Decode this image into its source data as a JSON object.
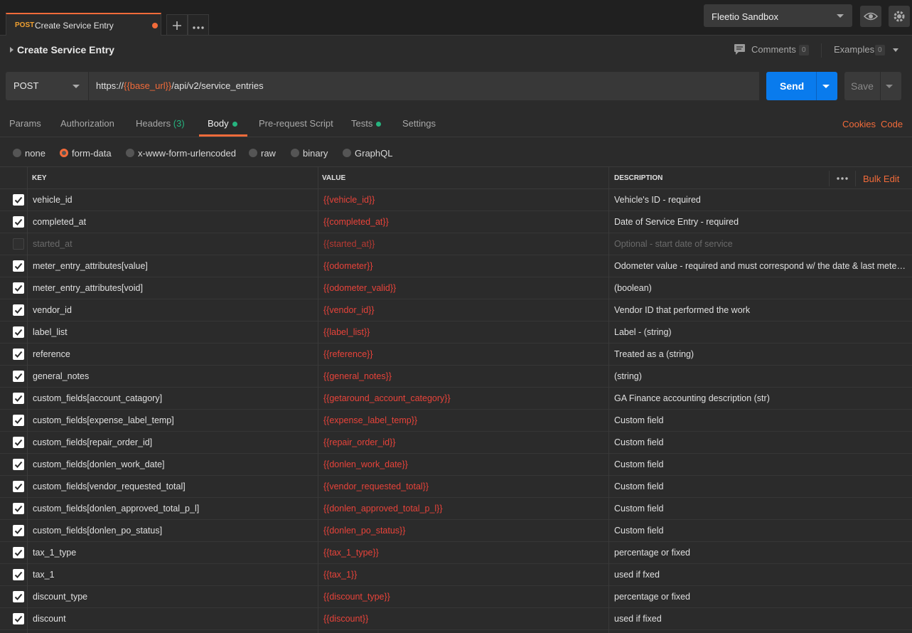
{
  "tab": {
    "method": "POST",
    "name": "Create Service Entry"
  },
  "environment": {
    "selected": "Fleetio Sandbox"
  },
  "request": {
    "title": "Create Service Entry",
    "comments_label": "Comments",
    "comments_count": "0",
    "examples_label": "Examples",
    "examples_count": "0",
    "method": "POST",
    "url_prefix": "https://",
    "url_var": "{{base_url}}",
    "url_suffix": "/api/v2/service_entries",
    "send_label": "Send",
    "save_label": "Save"
  },
  "subtabs": {
    "params": "Params",
    "authorization": "Authorization",
    "headers": "Headers",
    "headers_count": "(3)",
    "body": "Body",
    "prerequest": "Pre-request Script",
    "tests": "Tests",
    "settings": "Settings",
    "cookies": "Cookies",
    "code": "Code"
  },
  "body_types": [
    "none",
    "form-data",
    "x-www-form-urlencoded",
    "raw",
    "binary",
    "GraphQL"
  ],
  "body_type_selected": "form-data",
  "table": {
    "headers": {
      "key": "KEY",
      "value": "VALUE",
      "description": "DESCRIPTION",
      "bulk_edit": "Bulk Edit"
    },
    "rows": [
      {
        "checked": true,
        "key": "vehicle_id",
        "value": "{{vehicle_id}}",
        "description": "Vehicle's ID - required"
      },
      {
        "checked": true,
        "key": "completed_at",
        "value": "{{completed_at}}",
        "description": "Date of Service Entry - required"
      },
      {
        "checked": false,
        "key": "started_at",
        "value": "{{started_at}}",
        "description": "Optional - start date of service"
      },
      {
        "checked": true,
        "key": "meter_entry_attributes[value]",
        "value": "{{odometer}}",
        "description": "Odometer value - required and must correspond w/ the date & last meter entry"
      },
      {
        "checked": true,
        "key": "meter_entry_attributes[void]",
        "value": "{{odometer_valid}}",
        "description": "(boolean)"
      },
      {
        "checked": true,
        "key": "vendor_id",
        "value": "{{vendor_id}}",
        "description": "Vendor ID that performed the work"
      },
      {
        "checked": true,
        "key": "label_list",
        "value": "{{label_list}}",
        "description": "Label - (string)"
      },
      {
        "checked": true,
        "key": "reference",
        "value": "{{reference}}",
        "description": "Treated as a (string)"
      },
      {
        "checked": true,
        "key": "general_notes",
        "value": "{{general_notes}}",
        "description": "(string)"
      },
      {
        "checked": true,
        "key": "custom_fields[account_catagory]",
        "value": "{{getaround_account_category}}",
        "description": "GA Finance accounting description (str)"
      },
      {
        "checked": true,
        "key": "custom_fields[expense_label_temp]",
        "value": "{{expense_label_temp}}",
        "description": "Custom field"
      },
      {
        "checked": true,
        "key": "custom_fields[repair_order_id]",
        "value": "{{repair_order_id}}",
        "description": "Custom field"
      },
      {
        "checked": true,
        "key": "custom_fields[donlen_work_date]",
        "value": "{{donlen_work_date}}",
        "description": "Custom field"
      },
      {
        "checked": true,
        "key": "custom_fields[vendor_requested_total]",
        "value": "{{vendor_requested_total}}",
        "description": "Custom field"
      },
      {
        "checked": true,
        "key": "custom_fields[donlen_approved_total_p_l]",
        "value": "{{donlen_approved_total_p_l}}",
        "description": "Custom field"
      },
      {
        "checked": true,
        "key": "custom_fields[donlen_po_status]",
        "value": "{{donlen_po_status}}",
        "description": "Custom field"
      },
      {
        "checked": true,
        "key": "tax_1_type",
        "value": "{{tax_1_type}}",
        "description": "percentage or fixed"
      },
      {
        "checked": true,
        "key": "tax_1",
        "value": "{{tax_1}}",
        "description": "used if fxed"
      },
      {
        "checked": true,
        "key": "discount_type",
        "value": "{{discount_type}}",
        "description": "percentage or fixed"
      },
      {
        "checked": true,
        "key": "discount",
        "value": "{{discount}}",
        "description": "used if fixed"
      }
    ]
  },
  "colors": {
    "accent": "#f26b3a",
    "send": "#097bed",
    "value_text": "#e8433a",
    "dot": "#26b47f"
  }
}
